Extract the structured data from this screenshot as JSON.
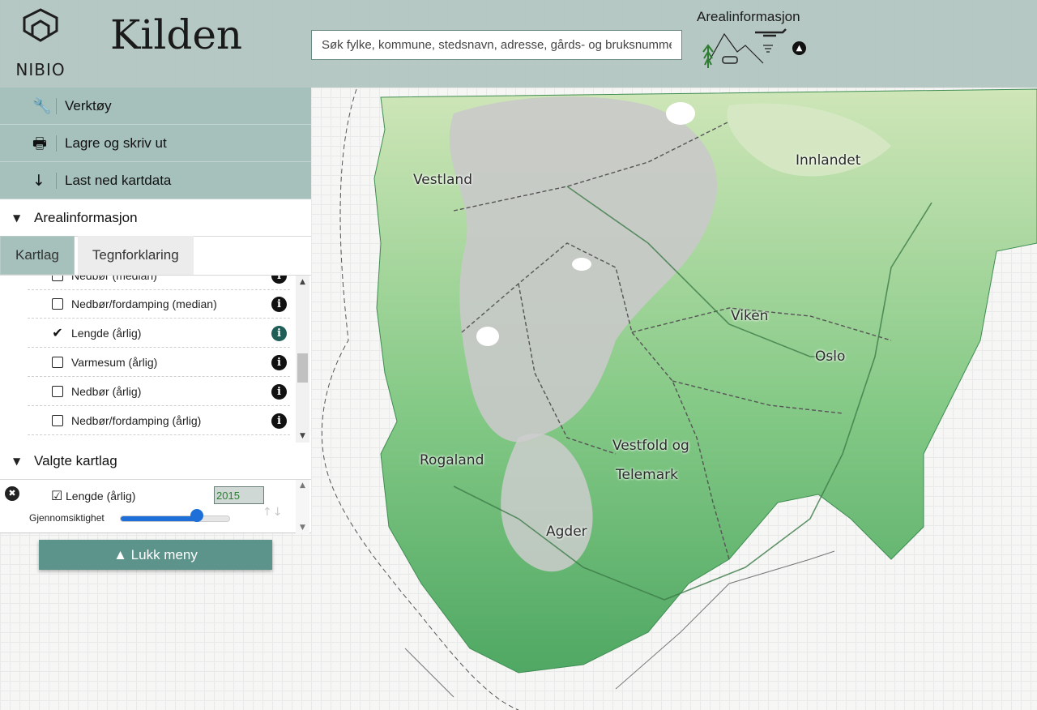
{
  "header": {
    "logo_text": "NIBIO",
    "app_title": "Kilden",
    "search_placeholder": "Søk fylke, kommune, stedsnavn, adresse, gårds- og bruksnummer",
    "theme_title": "Arealinformasjon"
  },
  "tools": [
    {
      "icon": "wrench-icon",
      "label": "Verktøy"
    },
    {
      "icon": "print-icon",
      "label": "Lagre og skriv ut"
    },
    {
      "icon": "download-icon",
      "label": "Last ned kartdata"
    }
  ],
  "sections": {
    "arealinformasjon": "Arealinformasjon",
    "valgte_kartlag": "Valgte kartlag"
  },
  "tabs": [
    {
      "label": "Kartlag",
      "active": true
    },
    {
      "label": "Tegnforklaring",
      "active": false
    }
  ],
  "layers": [
    {
      "name": "Nedbør (median)",
      "checked": false
    },
    {
      "name": "Nedbør/fordamping (median)",
      "checked": false
    },
    {
      "name": "Lengde (årlig)",
      "checked": true
    },
    {
      "name": "Varmesum (årlig)",
      "checked": false
    },
    {
      "name": "Nedbør (årlig)",
      "checked": false
    },
    {
      "name": "Nedbør/fordamping (årlig)",
      "checked": false
    }
  ],
  "selected_layer": {
    "name": "Lengde (årlig)",
    "year": "2015",
    "opacity_label": "Gjennomsiktighet",
    "opacity": 0.7
  },
  "close_menu_label": "Lukk meny",
  "map": {
    "regions": [
      "Vestland",
      "Innlandet",
      "Viken",
      "Oslo",
      "Vestfold og",
      "Telemark",
      "Rogaland",
      "Agder"
    ],
    "colors": {
      "land_green": "#5cb26e",
      "land_light": "#a6d79b",
      "mountain_grey": "#c8c8c8",
      "sea": "#f6f6f4"
    }
  }
}
